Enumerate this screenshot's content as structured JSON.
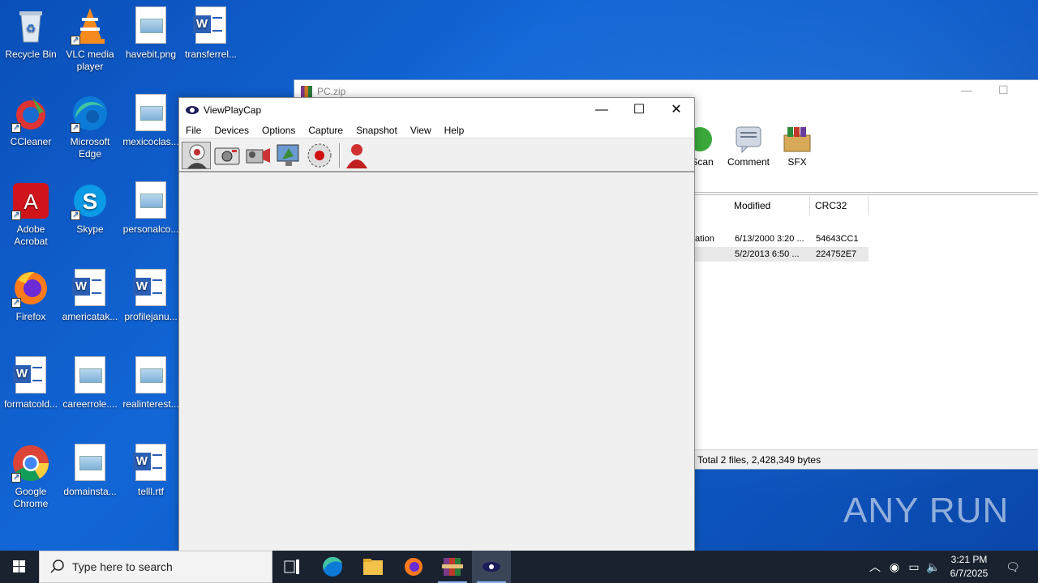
{
  "desktop": {
    "icons": [
      {
        "label": "Recycle Bin",
        "icon": "recycle-bin-icon"
      },
      {
        "label": "VLC media player",
        "icon": "vlc-icon"
      },
      {
        "label": "havebit.png",
        "icon": "image-file-icon"
      },
      {
        "label": "transferrel...",
        "icon": "word-doc-icon"
      },
      {
        "label": "CCleaner",
        "icon": "ccleaner-icon"
      },
      {
        "label": "Microsoft Edge",
        "icon": "edge-icon"
      },
      {
        "label": "mexicoclas...",
        "icon": "image-file-icon"
      },
      {
        "label": "Adobe Acrobat",
        "icon": "acrobat-icon"
      },
      {
        "label": "Skype",
        "icon": "skype-icon"
      },
      {
        "label": "personalco...",
        "icon": "image-file-icon"
      },
      {
        "label": "Firefox",
        "icon": "firefox-icon"
      },
      {
        "label": "americatak...",
        "icon": "word-doc-icon"
      },
      {
        "label": "profilejanu...",
        "icon": "word-doc-icon"
      },
      {
        "label": "formatcold...",
        "icon": "word-doc-icon"
      },
      {
        "label": "careerrole....",
        "icon": "image-file-icon"
      },
      {
        "label": "realinterest...",
        "icon": "image-file-icon"
      },
      {
        "label": "Google Chrome",
        "icon": "chrome-icon"
      },
      {
        "label": "domainsta...",
        "icon": "image-file-icon"
      },
      {
        "label": "telll.rtf",
        "icon": "word-doc-icon"
      }
    ]
  },
  "winrar": {
    "title": "PC.zip",
    "toolbar": {
      "scan_label": "sScan",
      "comment_label": "Comment",
      "sfx_label": "SFX"
    },
    "columns": {
      "modified": "Modified",
      "crc": "CRC32"
    },
    "rows": [
      {
        "type": "ation",
        "modified": "6/13/2000 3:20 ...",
        "crc": "54643CC1"
      },
      {
        "type": "",
        "modified": "5/2/2013 6:50 ...",
        "crc": "224752E7"
      }
    ],
    "status": "Total 2 files, 2,428,349 bytes"
  },
  "viewplaycap": {
    "title": "ViewPlayCap",
    "menu": [
      "File",
      "Devices",
      "Options",
      "Capture",
      "Snapshot",
      "View",
      "Help"
    ],
    "controls": {
      "minimize": "—",
      "maximize": "☐",
      "close": "✕"
    }
  },
  "taskbar": {
    "search_placeholder": "Type here to search",
    "time": "3:21 PM",
    "date": "6/7/2025"
  },
  "watermark": "ANY RUN",
  "colors": {
    "desktop": "#0f5cc9",
    "taskbar": "#1a2230",
    "accent": "#8ab4f8"
  }
}
